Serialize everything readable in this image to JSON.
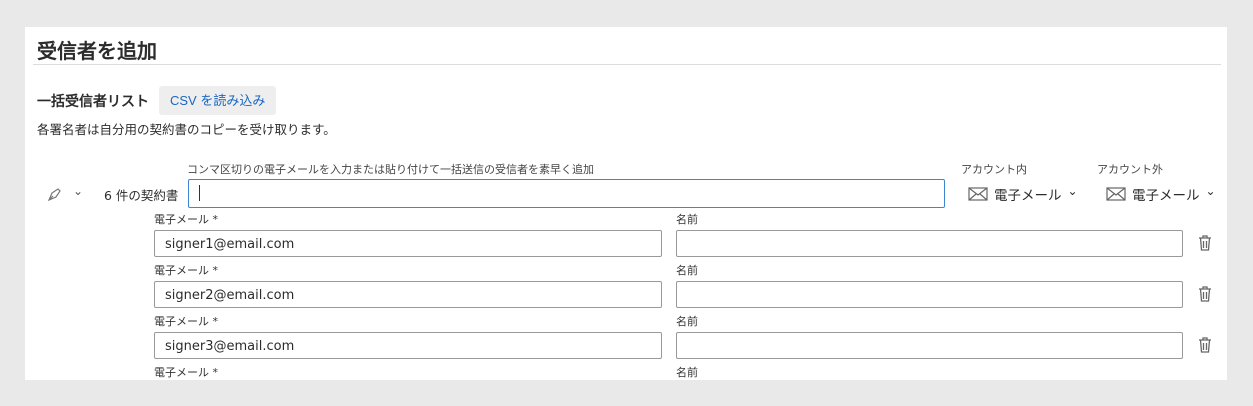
{
  "header": {
    "title": "受信者を追加"
  },
  "bulk": {
    "title": "一括受信者リスト",
    "csv_button": "CSV を読み込み",
    "description": "各署名者は自分用の契約書のコピーを受け取ります。"
  },
  "entry": {
    "hint": "コンマ区切りの電子メールを入力または貼り付けて一括送信の受信者を素早く追加",
    "count": "6 件の契約書",
    "value": ""
  },
  "accounts": {
    "internal_label": "アカウント内",
    "internal_value": "電子メール",
    "external_label": "アカウント外",
    "external_value": "電子メール"
  },
  "fields": {
    "email_label": "電子メール *",
    "name_label": "名前"
  },
  "rows": [
    {
      "email": "signer1@email.com",
      "name": ""
    },
    {
      "email": "signer2@email.com",
      "name": ""
    },
    {
      "email": "signer3@email.com",
      "name": ""
    },
    {
      "email": "",
      "name": ""
    }
  ]
}
